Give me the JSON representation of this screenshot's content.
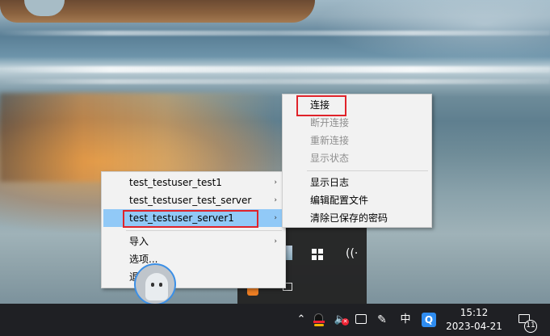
{
  "left_menu": {
    "items": [
      {
        "label": "test_testuser_test1",
        "submenu": true
      },
      {
        "label": "test_testuser_test_server",
        "submenu": true
      },
      {
        "label": "test_testuser_server1",
        "submenu": true,
        "highlighted": true
      },
      {
        "label": "导入",
        "submenu": true
      },
      {
        "label": "选项...",
        "submenu": false
      },
      {
        "label": "退出",
        "submenu": false
      }
    ],
    "arrow": "›"
  },
  "right_menu": {
    "items": [
      {
        "label": "连接",
        "enabled": true
      },
      {
        "label": "断开连接",
        "enabled": false
      },
      {
        "label": "重新连接",
        "enabled": false
      },
      {
        "label": "显示状态",
        "enabled": false
      },
      {
        "label": "显示日志",
        "enabled": true
      },
      {
        "label": "编辑配置文件",
        "enabled": true
      },
      {
        "label": "清除已保存的密码",
        "enabled": true
      }
    ]
  },
  "taskbar": {
    "chevron": "⌃",
    "volume_icon": "🔈",
    "volume_mute_mark": "✕",
    "pen_icon": "✎",
    "ime_label": "中",
    "app_q_label": "Q",
    "time": "15:12",
    "date": "2023-04-21",
    "notification_count": "11"
  },
  "tray_panel": {
    "wifi_icon": "((·"
  },
  "colors": {
    "highlight": "#91c9f7",
    "red_outline": "#e0232a",
    "taskbar_bg": "#1f2024",
    "menu_bg": "#f2f2f2"
  }
}
